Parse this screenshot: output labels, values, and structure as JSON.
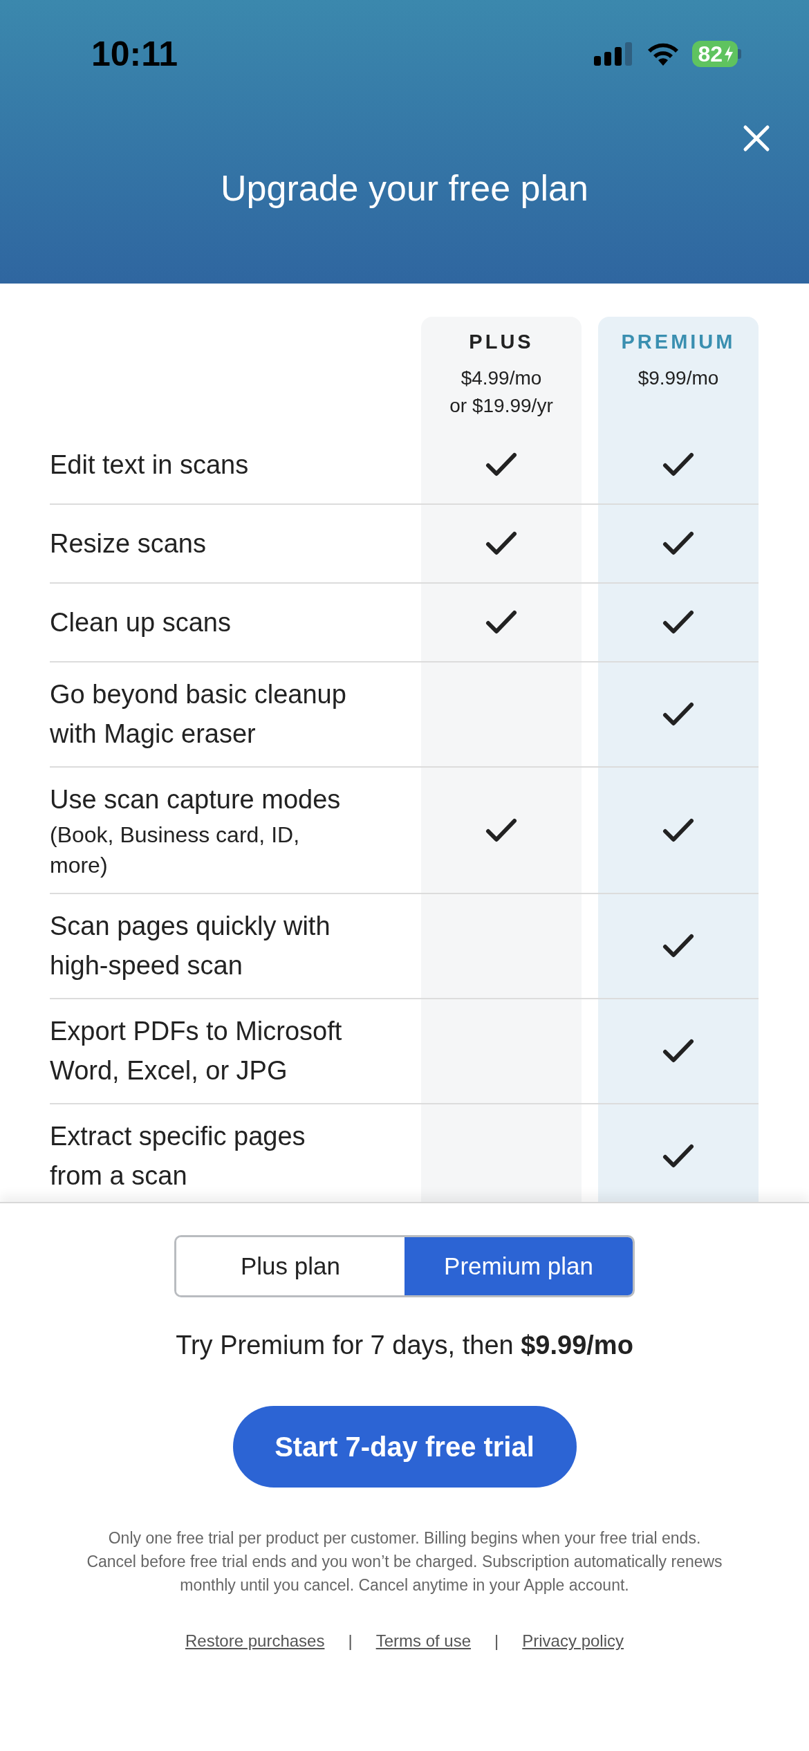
{
  "status_bar": {
    "time": "10:11",
    "battery": "82"
  },
  "title": "Upgrade your free plan",
  "plans": [
    {
      "name": "PLUS",
      "price": "$4.99/mo",
      "alt_price": "or $19.99/yr",
      "kind": "plus"
    },
    {
      "name": "PREMIUM",
      "price": "$9.99/mo",
      "kind": "premium"
    }
  ],
  "features": [
    {
      "text": "Edit text in scans",
      "included": [
        true,
        true
      ]
    },
    {
      "text": "Resize scans",
      "included": [
        true,
        true
      ]
    },
    {
      "text": "Clean up scans",
      "included": [
        true,
        true
      ]
    },
    {
      "text": "Go beyond basic cleanup with Magic eraser",
      "included": [
        false,
        true
      ]
    },
    {
      "text": "Use scan capture modes",
      "sub": "(Book, Business card, ID, more)",
      "included": [
        true,
        true
      ]
    },
    {
      "text": "Scan pages quickly with high-speed scan",
      "included": [
        false,
        true
      ]
    },
    {
      "text": "Export PDFs to Microsoft Word, Excel, or JPG",
      "included": [
        false,
        true
      ]
    },
    {
      "text": "Extract specific pages from a scan",
      "included": [
        false,
        true
      ]
    }
  ],
  "segments": [
    {
      "label": "Plus plan",
      "selected": false
    },
    {
      "label": "Premium plan",
      "selected": true
    }
  ],
  "offer": "Try Premium for 7 days, then **$9.99/mo**",
  "cta": "Start 7-day free trial",
  "disclaimer": "Only one free trial per product per customer. Billing begins when your free trial ends. Cancel before free trial ends and you won’t be charged. Subscription automatically renews monthly until you cancel. Cancel anytime in your Apple account.",
  "links": [
    "Restore purchases",
    "Terms of use",
    "Privacy policy"
  ],
  "link_separator": "|"
}
